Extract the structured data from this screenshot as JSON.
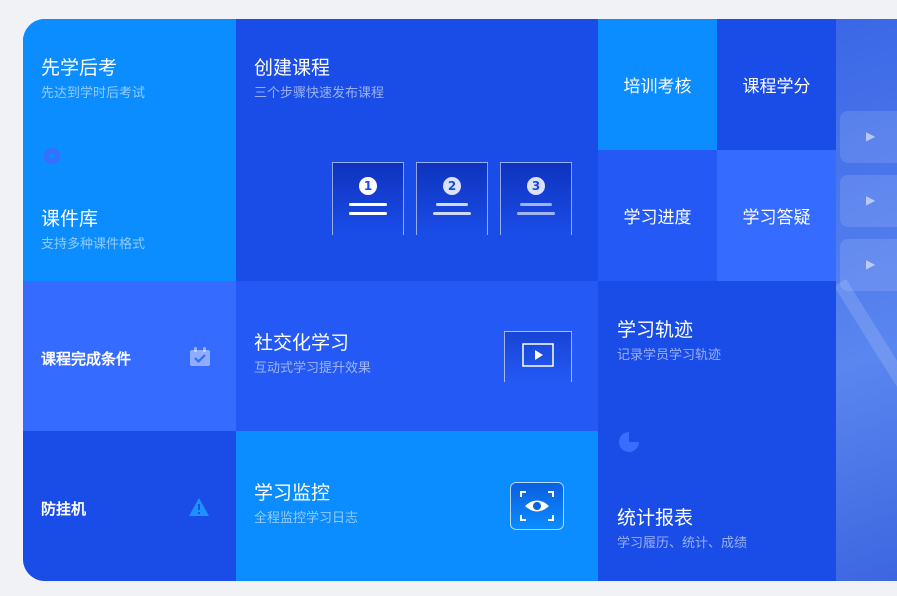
{
  "tiles": {
    "xianxue": {
      "title": "先学后考",
      "sub": "先达到学时后考试"
    },
    "kejianku": {
      "title": "课件库",
      "sub": "支持多种课件格式"
    },
    "chuangjian": {
      "title": "创建课程",
      "sub": "三个步骤快速发布课程",
      "steps": [
        "1",
        "2",
        "3"
      ]
    },
    "peixun": {
      "title": "培训考核"
    },
    "xuefen": {
      "title": "课程学分"
    },
    "jindu": {
      "title": "学习进度"
    },
    "dayi": {
      "title": "学习答疑"
    },
    "wancheng": {
      "title": "课程完成条件"
    },
    "shejiao": {
      "title": "社交化学习",
      "sub": "互动式学习提升效果"
    },
    "guiji": {
      "title": "学习轨迹",
      "sub": "记录学员学习轨迹"
    },
    "fangguaji": {
      "title": "防挂机"
    },
    "jiankong": {
      "title": "学习监控",
      "sub": "全程监控学习日志"
    },
    "baobiao": {
      "title": "统计报表",
      "sub": "学习履历、统计、成绩"
    }
  },
  "icons": {
    "courseware": "gear-icon",
    "complete": "calendar-check-icon",
    "social": "play-icon",
    "anti_idle": "warning-icon",
    "monitor": "eye-scan-icon",
    "report": "pie-chart-icon"
  },
  "colors": {
    "cyan": "#0b8cff",
    "blue": "#1a4de8",
    "mid": "#2459f5",
    "light": "#366bff"
  }
}
